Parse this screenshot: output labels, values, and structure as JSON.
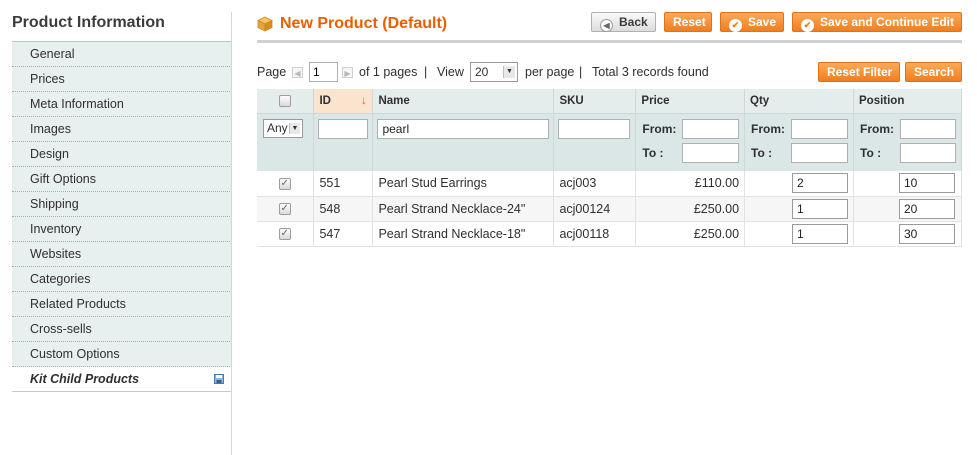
{
  "sidebar": {
    "title": "Product Information",
    "items": [
      {
        "label": "General"
      },
      {
        "label": "Prices"
      },
      {
        "label": "Meta Information"
      },
      {
        "label": "Images"
      },
      {
        "label": "Design"
      },
      {
        "label": "Gift Options"
      },
      {
        "label": "Shipping"
      },
      {
        "label": "Inventory"
      },
      {
        "label": "Websites"
      },
      {
        "label": "Categories"
      },
      {
        "label": "Related Products"
      },
      {
        "label": "Cross-sells"
      },
      {
        "label": "Custom Options"
      },
      {
        "label": "Kit Child Products"
      }
    ]
  },
  "header": {
    "title": "New Product (Default)",
    "back_label": "Back",
    "reset_label": "Reset",
    "save_label": "Save",
    "save_continue_label": "Save and Continue Edit"
  },
  "pager": {
    "page_label": "Page",
    "page_value": "1",
    "of_pages": "of 1 pages",
    "view_label": "View",
    "view_value": "20",
    "per_page": "per page",
    "total": "Total 3 records found",
    "reset_filter_label": "Reset Filter",
    "search_label": "Search"
  },
  "grid": {
    "columns": {
      "id": "ID",
      "name": "Name",
      "sku": "SKU",
      "price": "Price",
      "qty": "Qty",
      "position": "Position"
    },
    "filters": {
      "any": "Any",
      "id": "",
      "name": "pearl",
      "sku": "",
      "from_label": "From:",
      "to_label": "To :"
    },
    "rows": [
      {
        "id": "551",
        "name": "Pearl Stud Earrings",
        "sku": "acj003",
        "price": "£110.00",
        "qty": "2",
        "position": "10"
      },
      {
        "id": "548",
        "name": "Pearl Strand Necklace-24\"",
        "sku": "acj00124",
        "price": "£250.00",
        "qty": "1",
        "position": "20"
      },
      {
        "id": "547",
        "name": "Pearl Strand Necklace-18\"",
        "sku": "acj00118",
        "price": "£250.00",
        "qty": "1",
        "position": "30"
      }
    ]
  },
  "colors": {
    "accent": "#eb5e00",
    "button_orange": "#f07e1f",
    "sidebar_bg": "#e7efef"
  }
}
